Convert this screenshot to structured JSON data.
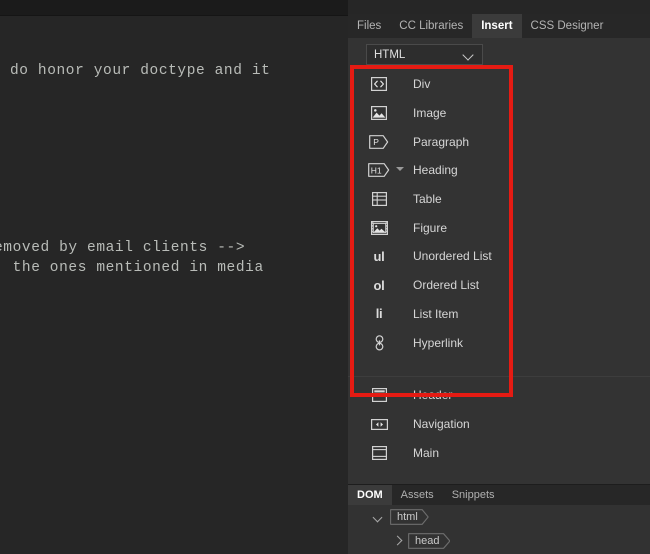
{
  "editor": {
    "code_lines": [
      "do honor your doctype and it",
      "emoved by email clients -->",
      "; the ones mentioned in media"
    ]
  },
  "panel": {
    "tabs": [
      {
        "label": "Files",
        "active": false
      },
      {
        "label": "CC Libraries",
        "active": false
      },
      {
        "label": "Insert",
        "active": true
      },
      {
        "label": "CSS Designer",
        "active": false
      }
    ],
    "category": {
      "selected": "HTML",
      "chevron_icon": "chevron-down-icon"
    },
    "primary_items": [
      {
        "label": "Div",
        "icon": "code-brackets-icon",
        "caret": false
      },
      {
        "label": "Image",
        "icon": "image-icon",
        "caret": false
      },
      {
        "label": "Paragraph",
        "icon": "paragraph-tag-icon",
        "caret": false
      },
      {
        "label": "Heading",
        "icon": "heading-tag-icon",
        "caret": true
      },
      {
        "label": "Table",
        "icon": "table-grid-icon",
        "caret": false
      },
      {
        "label": "Figure",
        "icon": "figure-icon",
        "caret": false
      },
      {
        "label": "Unordered List",
        "icon": "ul-text-icon",
        "caret": false,
        "text_icon": "ul"
      },
      {
        "label": "Ordered List",
        "icon": "ol-text-icon",
        "caret": false,
        "text_icon": "ol"
      },
      {
        "label": "List Item",
        "icon": "li-text-icon",
        "caret": false,
        "text_icon": "li"
      },
      {
        "label": "Hyperlink",
        "icon": "link-chain-icon",
        "caret": false
      }
    ],
    "secondary_items": [
      {
        "label": "Header",
        "icon": "header-block-icon"
      },
      {
        "label": "Navigation",
        "icon": "navigation-block-icon"
      },
      {
        "label": "Main",
        "icon": "main-block-icon"
      }
    ]
  },
  "dom_panel": {
    "tabs": [
      {
        "label": "DOM",
        "active": true
      },
      {
        "label": "Assets",
        "active": false
      },
      {
        "label": "Snippets",
        "active": false
      }
    ],
    "tree": [
      {
        "tag": "html",
        "expanded": true,
        "depth": 0
      },
      {
        "tag": "head",
        "expanded": false,
        "depth": 1
      }
    ]
  },
  "annotation": {
    "highlight_color": "#e51b13"
  }
}
